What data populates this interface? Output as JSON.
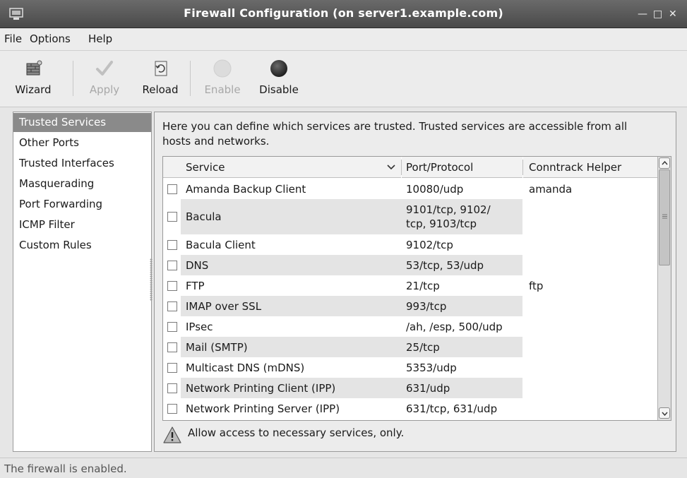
{
  "window": {
    "title": "Firewall Configuration (on server1.example.com)",
    "icon": "firewall-window-icon",
    "controls": [
      "minimize",
      "maximize",
      "close"
    ]
  },
  "menubar": {
    "items": [
      {
        "label": "File",
        "mnemonic": "F"
      },
      {
        "label": "Options",
        "mnemonic": "O"
      },
      {
        "label": "Help",
        "mnemonic": "H"
      }
    ]
  },
  "toolbar": {
    "wizard_label": "Wizard",
    "apply_label": "Apply",
    "reload_label": "Reload",
    "enable_label": "Enable",
    "disable_label": "Disable"
  },
  "sidebar": {
    "items": [
      {
        "label": "Trusted Services",
        "selected": true
      },
      {
        "label": "Other Ports",
        "selected": false
      },
      {
        "label": "Trusted Interfaces",
        "selected": false
      },
      {
        "label": "Masquerading",
        "selected": false
      },
      {
        "label": "Port Forwarding",
        "selected": false
      },
      {
        "label": "ICMP Filter",
        "selected": false
      },
      {
        "label": "Custom Rules",
        "selected": false
      }
    ]
  },
  "main": {
    "description": "Here you can define which services are trusted. Trusted services are accessible from all hosts and networks.",
    "table": {
      "columns": {
        "service": "Service",
        "port": "Port/Protocol",
        "helper": "Conntrack Helper"
      },
      "rows": [
        {
          "service": "Amanda Backup Client",
          "port": "10080/udp",
          "helper": "amanda",
          "checked": false
        },
        {
          "service": "Bacula",
          "port": "9101/tcp, 9102/\ntcp, 9103/tcp",
          "helper": "",
          "checked": false
        },
        {
          "service": "Bacula Client",
          "port": "9102/tcp",
          "helper": "",
          "checked": false
        },
        {
          "service": "DNS",
          "port": "53/tcp, 53/udp",
          "helper": "",
          "checked": false
        },
        {
          "service": "FTP",
          "port": "21/tcp",
          "helper": "ftp",
          "checked": false
        },
        {
          "service": "IMAP over SSL",
          "port": "993/tcp",
          "helper": "",
          "checked": false
        },
        {
          "service": "IPsec",
          "port": "/ah, /esp, 500/udp",
          "helper": "",
          "checked": false
        },
        {
          "service": "Mail (SMTP)",
          "port": "25/tcp",
          "helper": "",
          "checked": false
        },
        {
          "service": "Multicast DNS (mDNS)",
          "port": "5353/udp",
          "helper": "",
          "checked": false
        },
        {
          "service": "Network Printing Client (IPP)",
          "port": "631/udp",
          "helper": "",
          "checked": false
        },
        {
          "service": "Network Printing Server (IPP)",
          "port": "631/tcp, 631/udp",
          "helper": "",
          "checked": false
        }
      ]
    },
    "warning": "Allow access to necessary services, only."
  },
  "status": {
    "text": "The firewall is enabled."
  },
  "colors": {
    "titlebar": "#555555",
    "selection": "#8a8a8a",
    "alt_column": "#e4e4e4",
    "enable_icon": "#dcdcdc",
    "disable_icon": "#2e2e2e"
  }
}
